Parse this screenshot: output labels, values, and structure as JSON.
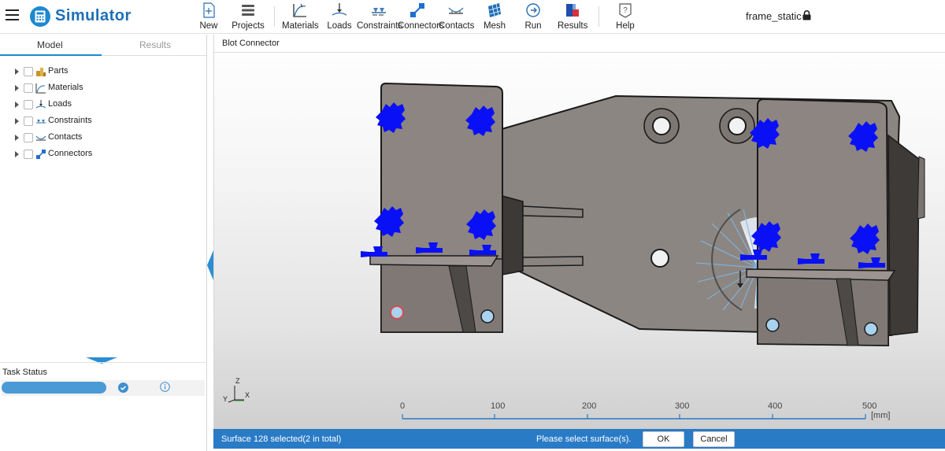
{
  "app": {
    "name": "Simulator",
    "document_title": "frame_static"
  },
  "toolbar": [
    {
      "label": "New",
      "icon": "new-file-icon"
    },
    {
      "label": "Projects",
      "icon": "projects-icon"
    },
    {
      "label": "Materials",
      "icon": "materials-icon"
    },
    {
      "label": "Loads",
      "icon": "loads-icon"
    },
    {
      "label": "Constraints",
      "icon": "constraints-icon"
    },
    {
      "label": "Connectors",
      "icon": "connectors-icon"
    },
    {
      "label": "Contacts",
      "icon": "contacts-icon"
    },
    {
      "label": "Mesh",
      "icon": "mesh-icon"
    },
    {
      "label": "Run",
      "icon": "run-icon"
    },
    {
      "label": "Results",
      "icon": "results-icon"
    },
    {
      "label": "Help",
      "icon": "help-icon"
    }
  ],
  "left_panel": {
    "tabs": [
      {
        "label": "Model",
        "active": true
      },
      {
        "label": "Results",
        "active": false
      }
    ],
    "tree": [
      {
        "label": "Parts",
        "icon": "parts-icon"
      },
      {
        "label": "Materials",
        "icon": "materials-icon"
      },
      {
        "label": "Loads",
        "icon": "loads-icon"
      },
      {
        "label": "Constraints",
        "icon": "constraints-icon"
      },
      {
        "label": "Contacts",
        "icon": "contacts-icon"
      },
      {
        "label": "Connectors",
        "icon": "connectors-icon"
      }
    ],
    "task_status": {
      "title": "Task Status",
      "progress": 1.0
    }
  },
  "viewport": {
    "title": "Blot Connector",
    "axes": {
      "z": "Z",
      "x": "X",
      "y": "Y"
    },
    "scale": {
      "ticks": [
        "0",
        "100",
        "200",
        "300",
        "400",
        "500"
      ],
      "unit": "[mm]"
    }
  },
  "statusbar": {
    "selection": "Surface 128 selected(2 in total)",
    "prompt": "Please select surface(s).",
    "ok_label": "OK",
    "cancel_label": "Cancel"
  },
  "colors": {
    "accent": "#2a7bc6",
    "brand": "#1e6fb8",
    "connector_blue": "#0a10f5",
    "part_gray": "#8c8581"
  }
}
